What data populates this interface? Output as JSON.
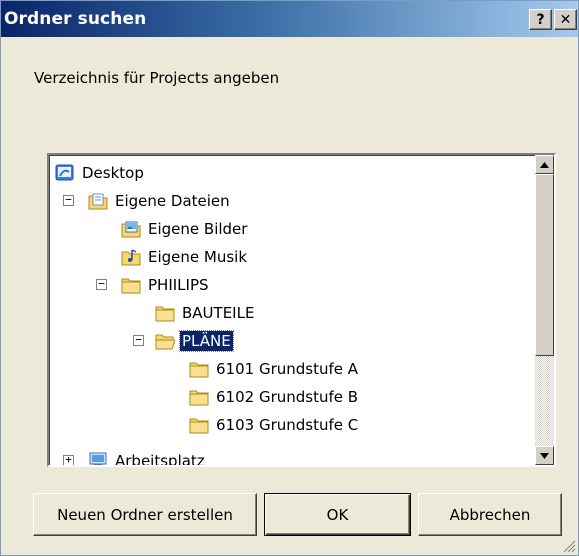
{
  "window": {
    "title": "Ordner suchen",
    "help_label": "?",
    "close_label": "✕"
  },
  "instruction": "Verzeichnis für Projects angeben",
  "tree": {
    "items": [
      {
        "label": "Desktop",
        "icon": "desktop-icon"
      },
      {
        "label": "Eigene Dateien",
        "icon": "my-documents-icon",
        "expander": "−"
      },
      {
        "label": "Eigene Bilder",
        "icon": "my-pictures-icon"
      },
      {
        "label": "Eigene Musik",
        "icon": "my-music-icon"
      },
      {
        "label": "PHIILIPS",
        "icon": "folder-icon",
        "expander": "−"
      },
      {
        "label": "BAUTEILE",
        "icon": "folder-icon"
      },
      {
        "label": "PLÄNE",
        "icon": "open-folder-icon",
        "expander": "−",
        "selected": true
      },
      {
        "label": "6101 Grundstufe A",
        "icon": "folder-icon"
      },
      {
        "label": "6102 Grundstufe B",
        "icon": "folder-icon"
      },
      {
        "label": "6103 Grundstufe C",
        "icon": "folder-icon"
      },
      {
        "label": "Arbeitsplatz",
        "icon": "my-computer-icon",
        "expander": "+"
      }
    ]
  },
  "buttons": {
    "new_folder": "Neuen Ordner erstellen",
    "ok": "OK",
    "cancel": "Abbrechen"
  },
  "colors": {
    "titlebar_start": "#0a246a",
    "titlebar_end": "#a6caf0",
    "selection": "#0a246a",
    "dialog_bg": "#ece9d8"
  }
}
